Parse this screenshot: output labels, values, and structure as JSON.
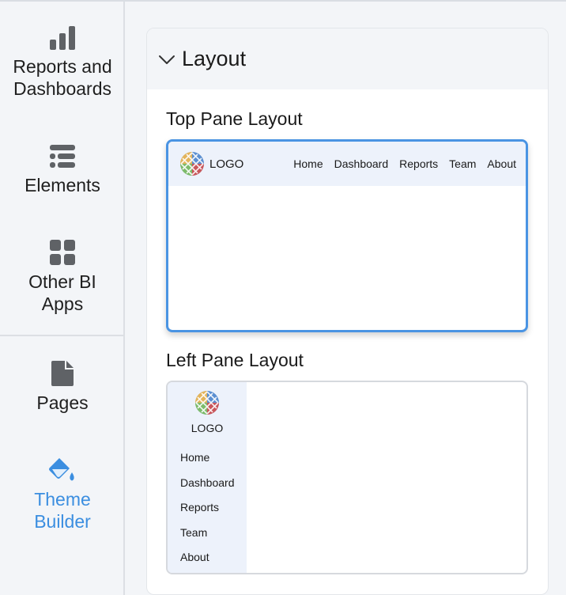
{
  "sidebar": {
    "items": [
      {
        "label": "Reports and\nDashboards",
        "icon": "bar-chart-icon"
      },
      {
        "label": "Elements",
        "icon": "elements-list-icon"
      },
      {
        "label": "Other BI\nApps",
        "icon": "apps-grid-icon"
      },
      {
        "label": "Pages",
        "icon": "page-icon"
      },
      {
        "label": "Theme\nBuilder",
        "icon": "paint-bucket-icon",
        "active": true
      }
    ]
  },
  "panel": {
    "title": "Layout",
    "sections": {
      "top": {
        "title": "Top Pane Layout",
        "logo_text": "LOGO",
        "links": [
          "Home",
          "Dashboard",
          "Reports",
          "Team",
          "About"
        ]
      },
      "left": {
        "title": "Left Pane Layout",
        "logo_text": "LOGO",
        "links": [
          "Home",
          "Dashboard",
          "Reports",
          "Team",
          "About"
        ]
      }
    }
  },
  "colors": {
    "accent": "#3b8ee0",
    "selected_border": "#4a94e3",
    "pane_bg": "#edf2fb"
  }
}
